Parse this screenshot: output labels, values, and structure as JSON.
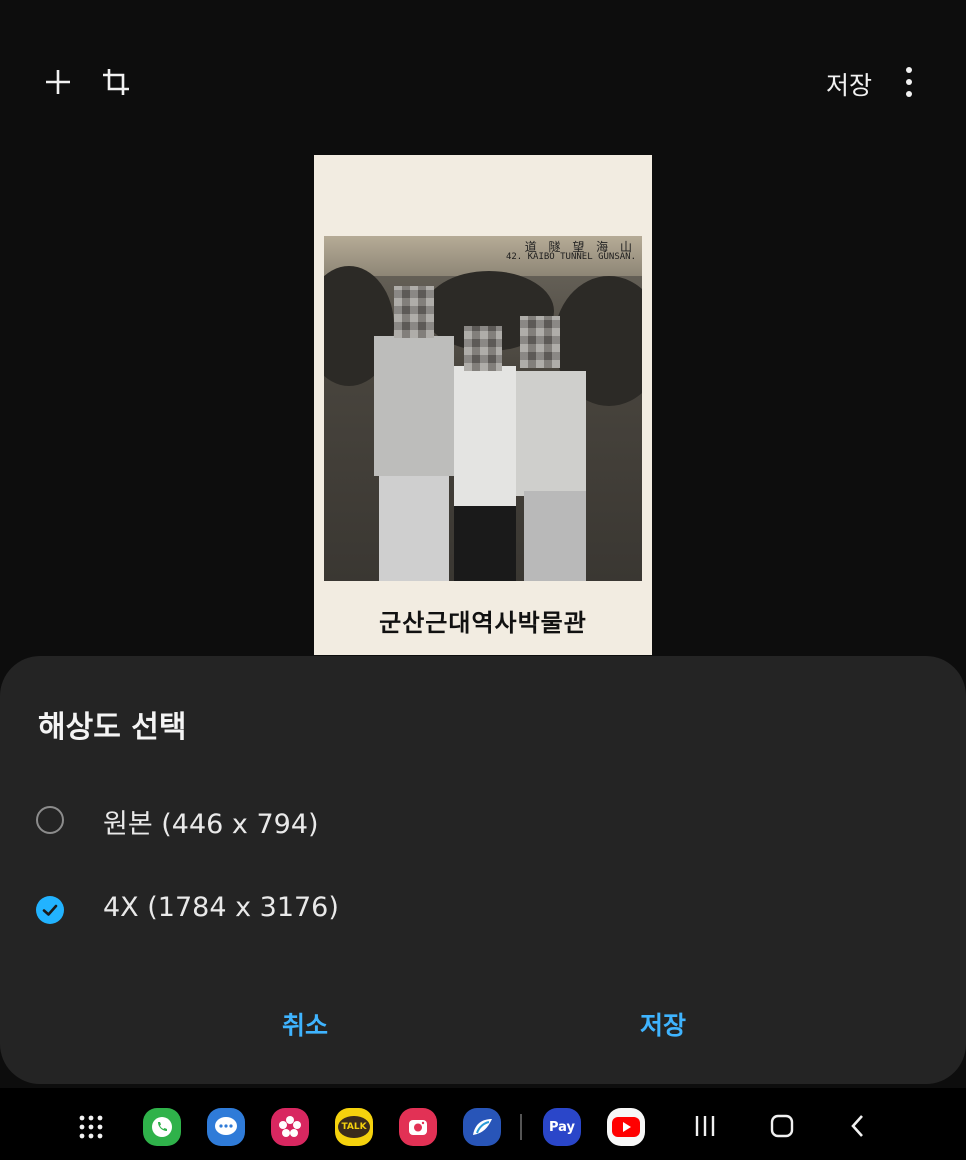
{
  "topbar": {
    "save_label": "저장"
  },
  "photo": {
    "hanja_text": "道 隧 望 海 山",
    "english_text": "42.  KAIBO TUNNEL GUNSAN.",
    "caption": "군산근대역사박물관"
  },
  "sheet": {
    "title": "해상도 선택",
    "options": [
      {
        "label": "원본 (446 x 794)",
        "selected": false
      },
      {
        "label": "4X (1784 x 3176)",
        "selected": true
      }
    ],
    "cancel_label": "취소",
    "save_label": "저장"
  },
  "navbar": {
    "kakao_label": "TALK",
    "pay_label": "Pay"
  },
  "colors": {
    "accent": "#3fb4ff",
    "sheet_bg": "#242424",
    "background": "#0d0d0d"
  }
}
